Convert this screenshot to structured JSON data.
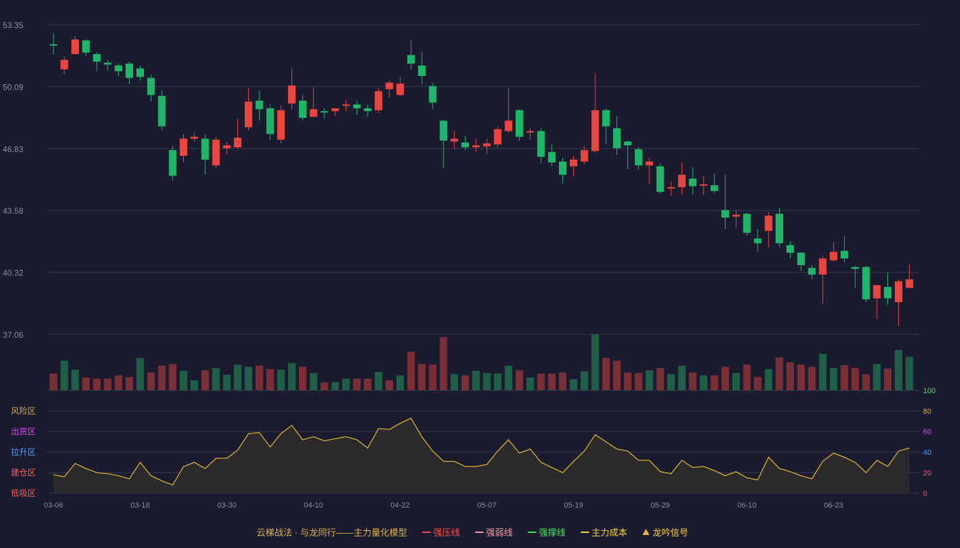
{
  "chart_data": {
    "type": "candlestick",
    "price_axis": {
      "ticks": [
        "53.35",
        "50.09",
        "46.83",
        "43.58",
        "40.32",
        "37.06"
      ],
      "range": [
        37.06,
        53.35
      ]
    },
    "x_tick_labels": [
      "03-06",
      "03-18",
      "03-30",
      "04-10",
      "04-22",
      "05-07",
      "05-19",
      "05-29",
      "06-10",
      "06-23"
    ],
    "x_tick_indices": [
      0,
      8,
      16,
      24,
      32,
      40,
      48,
      56,
      64,
      72
    ],
    "candles": [
      [
        52.32,
        52.36,
        52.32,
        52.4
      ],
      [
        51.5,
        51.5,
        51.0,
        51.05
      ],
      [
        51.8,
        51.8,
        52.57,
        52.6
      ],
      [
        52.52,
        52.52,
        51.88,
        51.83
      ],
      [
        51.8,
        51.8,
        51.4,
        51.35
      ],
      [
        51.35,
        51.35,
        51.25,
        51.2
      ],
      [
        51.2,
        51.2,
        50.9,
        50.8
      ],
      [
        51.3,
        51.3,
        50.55,
        50.5
      ],
      [
        50.6,
        50.6,
        51.05,
        51.1
      ],
      [
        50.55,
        50.55,
        49.65,
        49.6
      ],
      [
        49.6,
        49.6,
        48.0,
        47.9
      ],
      [
        46.75,
        46.75,
        45.4,
        45.3
      ],
      [
        46.45,
        46.45,
        47.35,
        47.4
      ],
      [
        47.35,
        47.35,
        47.45,
        47.5
      ],
      [
        47.35,
        47.35,
        46.25,
        45.95
      ],
      [
        45.95,
        45.95,
        47.3,
        47.35
      ],
      [
        46.85,
        46.85,
        47.0,
        47.05
      ],
      [
        46.9,
        46.9,
        47.4,
        47.45
      ],
      [
        47.95,
        47.95,
        49.3,
        49.4
      ],
      [
        49.35,
        49.35,
        48.9,
        48.8
      ],
      [
        48.95,
        48.95,
        47.6,
        47.5
      ],
      [
        47.3,
        47.3,
        48.85,
        48.9
      ],
      [
        49.2,
        49.2,
        50.15,
        50.2
      ],
      [
        49.35,
        49.35,
        48.45,
        48.35
      ],
      [
        48.5,
        48.5,
        48.9,
        48.95
      ],
      [
        48.8,
        48.8,
        48.75,
        48.7
      ],
      [
        48.8,
        48.8,
        48.95,
        49.0
      ],
      [
        49.1,
        49.1,
        49.15,
        49.2
      ],
      [
        49.15,
        49.15,
        48.95,
        48.9
      ],
      [
        48.95,
        48.95,
        48.8,
        48.75
      ],
      [
        48.85,
        48.85,
        49.85,
        49.9
      ],
      [
        49.95,
        49.95,
        50.3,
        50.35
      ],
      [
        49.65,
        49.65,
        50.25,
        50.35
      ],
      [
        51.3,
        51.3,
        51.75,
        51.85
      ],
      [
        51.2,
        51.2,
        50.65,
        50.45
      ],
      [
        50.12,
        50.12,
        49.25,
        49.15
      ],
      [
        48.3,
        48.3,
        47.25,
        47.0
      ],
      [
        47.35,
        47.35,
        47.2,
        47.15
      ],
      [
        47.15,
        47.15,
        46.9,
        46.85
      ],
      [
        46.9,
        46.9,
        47.0,
        47.05
      ],
      [
        46.95,
        46.95,
        47.1,
        47.15
      ],
      [
        47.05,
        47.05,
        47.85,
        47.9
      ],
      [
        47.75,
        47.75,
        48.3,
        48.45
      ],
      [
        48.85,
        48.85,
        47.45,
        47.35
      ],
      [
        47.7,
        47.7,
        47.75,
        47.8
      ],
      [
        47.75,
        47.75,
        46.4,
        46.3
      ],
      [
        46.65,
        46.65,
        46.1,
        46.0
      ],
      [
        46.15,
        46.15,
        45.45,
        45.3
      ],
      [
        45.9,
        45.9,
        46.25,
        46.3
      ],
      [
        46.15,
        46.15,
        46.75,
        46.8
      ],
      [
        46.7,
        46.7,
        48.85,
        48.9
      ],
      [
        48.85,
        48.85,
        48.0,
        47.9
      ],
      [
        47.9,
        47.9,
        46.85,
        46.7
      ],
      [
        47.2,
        47.2,
        47.0,
        46.9
      ],
      [
        46.8,
        46.8,
        45.95,
        45.9
      ],
      [
        45.95,
        45.95,
        46.15,
        46.2
      ],
      [
        45.9,
        45.9,
        44.55,
        44.5
      ],
      [
        44.8,
        44.8,
        44.75,
        44.7
      ],
      [
        44.8,
        44.8,
        45.45,
        45.5
      ],
      [
        45.25,
        45.25,
        44.85,
        44.75
      ],
      [
        44.9,
        44.9,
        44.95,
        45.0
      ],
      [
        44.9,
        44.9,
        44.6,
        44.5
      ],
      [
        43.6,
        43.6,
        43.2,
        43.05
      ],
      [
        43.25,
        43.25,
        43.35,
        43.4
      ],
      [
        43.4,
        43.4,
        42.4,
        42.25
      ],
      [
        42.1,
        42.1,
        41.85,
        41.75
      ],
      [
        42.5,
        42.5,
        43.3,
        43.4
      ],
      [
        43.4,
        43.4,
        41.85,
        41.75
      ],
      [
        41.75,
        41.75,
        41.35,
        41.25
      ],
      [
        41.35,
        41.35,
        40.7,
        40.55
      ],
      [
        40.55,
        40.55,
        40.2,
        40.05
      ],
      [
        40.2,
        40.2,
        41.05,
        41.1
      ],
      [
        40.95,
        40.95,
        41.4,
        41.5
      ],
      [
        41.45,
        41.45,
        41.05,
        40.95
      ],
      [
        40.6,
        40.6,
        40.5,
        40.4
      ],
      [
        40.6,
        40.6,
        38.9,
        38.8
      ],
      [
        38.95,
        38.95,
        39.65,
        39.7
      ],
      [
        39.55,
        39.55,
        38.95,
        38.8
      ],
      [
        38.75,
        38.75,
        39.85,
        39.95
      ],
      [
        39.5,
        39.5,
        39.95,
        40.05
      ]
    ],
    "wicks": [
      [
        52.9,
        51.8
      ],
      [
        51.7,
        50.75
      ],
      [
        52.75,
        51.8
      ],
      [
        52.6,
        51.7
      ],
      [
        51.9,
        50.9
      ],
      [
        51.5,
        50.95
      ],
      [
        51.3,
        50.65
      ],
      [
        51.4,
        50.2
      ],
      [
        51.2,
        50.4
      ],
      [
        50.7,
        49.3
      ],
      [
        49.9,
        47.8
      ],
      [
        47.0,
        45.15
      ],
      [
        47.6,
        46.1
      ],
      [
        47.65,
        47.2
      ],
      [
        47.6,
        45.45
      ],
      [
        47.45,
        45.8
      ],
      [
        47.2,
        46.5
      ],
      [
        48.4,
        46.8
      ],
      [
        50.0,
        47.8
      ],
      [
        49.9,
        48.3
      ],
      [
        49.15,
        47.3
      ],
      [
        49.1,
        47.1
      ],
      [
        51.1,
        48.9
      ],
      [
        49.65,
        48.3
      ],
      [
        50.05,
        48.5
      ],
      [
        48.95,
        48.4
      ],
      [
        48.95,
        48.55
      ],
      [
        49.4,
        48.8
      ],
      [
        49.35,
        48.6
      ],
      [
        49.15,
        48.5
      ],
      [
        50.05,
        48.7
      ],
      [
        50.4,
        49.5
      ],
      [
        50.6,
        49.6
      ],
      [
        52.55,
        51.0
      ],
      [
        51.9,
        50.2
      ],
      [
        50.3,
        48.9
      ],
      [
        48.35,
        45.8
      ],
      [
        47.75,
        46.8
      ],
      [
        47.5,
        46.75
      ],
      [
        47.35,
        46.65
      ],
      [
        47.35,
        46.55
      ],
      [
        48.0,
        46.9
      ],
      [
        50.0,
        47.7
      ],
      [
        48.9,
        47.25
      ],
      [
        47.95,
        47.3
      ],
      [
        47.9,
        46.05
      ],
      [
        47.05,
        45.9
      ],
      [
        46.35,
        45.0
      ],
      [
        46.45,
        45.35
      ],
      [
        46.95,
        46.0
      ],
      [
        50.8,
        46.6
      ],
      [
        48.95,
        47.05
      ],
      [
        48.55,
        46.5
      ],
      [
        47.25,
        45.75
      ],
      [
        46.9,
        45.7
      ],
      [
        46.35,
        44.95
      ],
      [
        46.05,
        44.45
      ],
      [
        45.1,
        44.35
      ],
      [
        46.1,
        44.4
      ],
      [
        45.85,
        44.4
      ],
      [
        45.4,
        44.4
      ],
      [
        45.5,
        44.5
      ],
      [
        45.45,
        42.6
      ],
      [
        43.6,
        42.65
      ],
      [
        43.45,
        42.25
      ],
      [
        42.6,
        41.4
      ],
      [
        43.5,
        41.65
      ],
      [
        43.7,
        41.65
      ],
      [
        41.95,
        41.05
      ],
      [
        41.4,
        40.4
      ],
      [
        40.7,
        39.95
      ],
      [
        41.2,
        38.65
      ],
      [
        41.9,
        40.9
      ],
      [
        42.25,
        40.85
      ],
      [
        40.65,
        39.5
      ],
      [
        40.65,
        38.75
      ],
      [
        39.65,
        37.85
      ],
      [
        40.3,
        38.6
      ],
      [
        39.95,
        37.5
      ],
      [
        40.75,
        39.5
      ]
    ],
    "candle_dirs": [
      "d",
      "u",
      "u",
      "d",
      "d",
      "d",
      "d",
      "d",
      "d",
      "d",
      "d",
      "d",
      "u",
      "u",
      "d",
      "u",
      "u",
      "u",
      "u",
      "d",
      "d",
      "u",
      "u",
      "d",
      "u",
      "d",
      "u",
      "u",
      "d",
      "d",
      "u",
      "u",
      "u",
      "d",
      "d",
      "d",
      "d",
      "u",
      "d",
      "u",
      "u",
      "u",
      "u",
      "d",
      "u",
      "d",
      "d",
      "d",
      "u",
      "u",
      "u",
      "d",
      "d",
      "d",
      "d",
      "u",
      "d",
      "u",
      "u",
      "d",
      "u",
      "d",
      "d",
      "u",
      "d",
      "d",
      "u",
      "d",
      "d",
      "d",
      "d",
      "u",
      "u",
      "d",
      "d",
      "d",
      "u",
      "d",
      "u",
      "u"
    ],
    "volume": [
      [
        "u",
        0.3
      ],
      [
        "d",
        0.53
      ],
      [
        "d",
        0.37
      ],
      [
        "u",
        0.23
      ],
      [
        "u",
        0.21
      ],
      [
        "u",
        0.21
      ],
      [
        "u",
        0.27
      ],
      [
        "u",
        0.24
      ],
      [
        "d",
        0.58
      ],
      [
        "u",
        0.32
      ],
      [
        "u",
        0.44
      ],
      [
        "u",
        0.47
      ],
      [
        "d",
        0.35
      ],
      [
        "d",
        0.18
      ],
      [
        "u",
        0.36
      ],
      [
        "d",
        0.4
      ],
      [
        "d",
        0.28
      ],
      [
        "d",
        0.46
      ],
      [
        "d",
        0.42
      ],
      [
        "u",
        0.44
      ],
      [
        "u",
        0.38
      ],
      [
        "d",
        0.37
      ],
      [
        "d",
        0.49
      ],
      [
        "u",
        0.42
      ],
      [
        "d",
        0.31
      ],
      [
        "u",
        0.14
      ],
      [
        "d",
        0.15
      ],
      [
        "d",
        0.21
      ],
      [
        "u",
        0.21
      ],
      [
        "u",
        0.21
      ],
      [
        "d",
        0.33
      ],
      [
        "u",
        0.18
      ],
      [
        "d",
        0.27
      ],
      [
        "u",
        0.69
      ],
      [
        "u",
        0.47
      ],
      [
        "u",
        0.46
      ],
      [
        "u",
        0.95
      ],
      [
        "d",
        0.29
      ],
      [
        "u",
        0.27
      ],
      [
        "d",
        0.35
      ],
      [
        "d",
        0.31
      ],
      [
        "d",
        0.3
      ],
      [
        "d",
        0.44
      ],
      [
        "u",
        0.36
      ],
      [
        "d",
        0.23
      ],
      [
        "u",
        0.3
      ],
      [
        "u",
        0.3
      ],
      [
        "u",
        0.32
      ],
      [
        "d",
        0.2
      ],
      [
        "d",
        0.34
      ],
      [
        "d",
        1.0
      ],
      [
        "u",
        0.58
      ],
      [
        "u",
        0.53
      ],
      [
        "u",
        0.32
      ],
      [
        "u",
        0.31
      ],
      [
        "d",
        0.36
      ],
      [
        "u",
        0.4
      ],
      [
        "d",
        0.29
      ],
      [
        "d",
        0.44
      ],
      [
        "u",
        0.32
      ],
      [
        "d",
        0.27
      ],
      [
        "u",
        0.27
      ],
      [
        "u",
        0.42
      ],
      [
        "d",
        0.31
      ],
      [
        "u",
        0.46
      ],
      [
        "u",
        0.24
      ],
      [
        "d",
        0.38
      ],
      [
        "u",
        0.59
      ],
      [
        "u",
        0.5
      ],
      [
        "u",
        0.46
      ],
      [
        "u",
        0.42
      ],
      [
        "d",
        0.65
      ],
      [
        "d",
        0.4
      ],
      [
        "u",
        0.45
      ],
      [
        "u",
        0.4
      ],
      [
        "u",
        0.29
      ],
      [
        "d",
        0.47
      ],
      [
        "u",
        0.39
      ],
      [
        "d",
        0.72
      ],
      [
        "d",
        0.6
      ]
    ],
    "oscillator": {
      "ticks_right": [
        "100",
        "80",
        "60",
        "40",
        "20",
        "0"
      ],
      "range": [
        0,
        100
      ],
      "zones": [
        "风险区",
        "出货区",
        "拉升区",
        "建仓区",
        "低吸区"
      ],
      "zone_colors": [
        "#d9a03a",
        "#e040fb",
        "#4f9cff",
        "#ff5a5a",
        "#ff5a5a"
      ],
      "values": [
        18,
        16,
        29,
        24,
        20,
        19,
        17,
        14,
        30,
        17,
        12,
        8,
        26,
        30,
        24,
        34,
        34,
        42,
        58,
        59,
        45,
        58,
        66,
        52,
        55,
        51,
        53,
        55,
        52,
        44,
        63,
        62,
        68,
        73,
        55,
        41,
        31,
        31,
        26,
        26,
        28,
        41,
        52,
        39,
        43,
        30,
        25,
        20,
        31,
        41,
        57,
        50,
        43,
        41,
        32,
        32,
        21,
        19,
        32,
        25,
        26,
        22,
        17,
        21,
        15,
        13,
        35,
        24,
        21,
        17,
        14,
        31,
        39,
        35,
        30,
        20,
        32,
        26,
        41,
        44
      ]
    }
  },
  "colors": {
    "up": "#e8463f",
    "down": "#1fb66a",
    "vol_up": "#7a2f36",
    "vol_down": "#1f5f47",
    "osc_line": "#d9b026",
    "osc_fill": "#2f2c2a",
    "grid": "#353850",
    "axis_text": "#8a8d9e"
  },
  "legend": {
    "title": "云梯战法 · 与龙同行——主力量化模型",
    "items": [
      {
        "label": "强压线",
        "color": "#ff4d4d",
        "style": "solid"
      },
      {
        "label": "强弱线",
        "color": "#ff9aa8",
        "style": "dashed"
      },
      {
        "label": "强撑线",
        "color": "#3ee65e",
        "style": "solid"
      },
      {
        "label": "主力成本",
        "color": "#ffd23a",
        "style": "dashed"
      }
    ],
    "signal_label": "龙吟信号",
    "signal_color": "#e8b43a"
  }
}
